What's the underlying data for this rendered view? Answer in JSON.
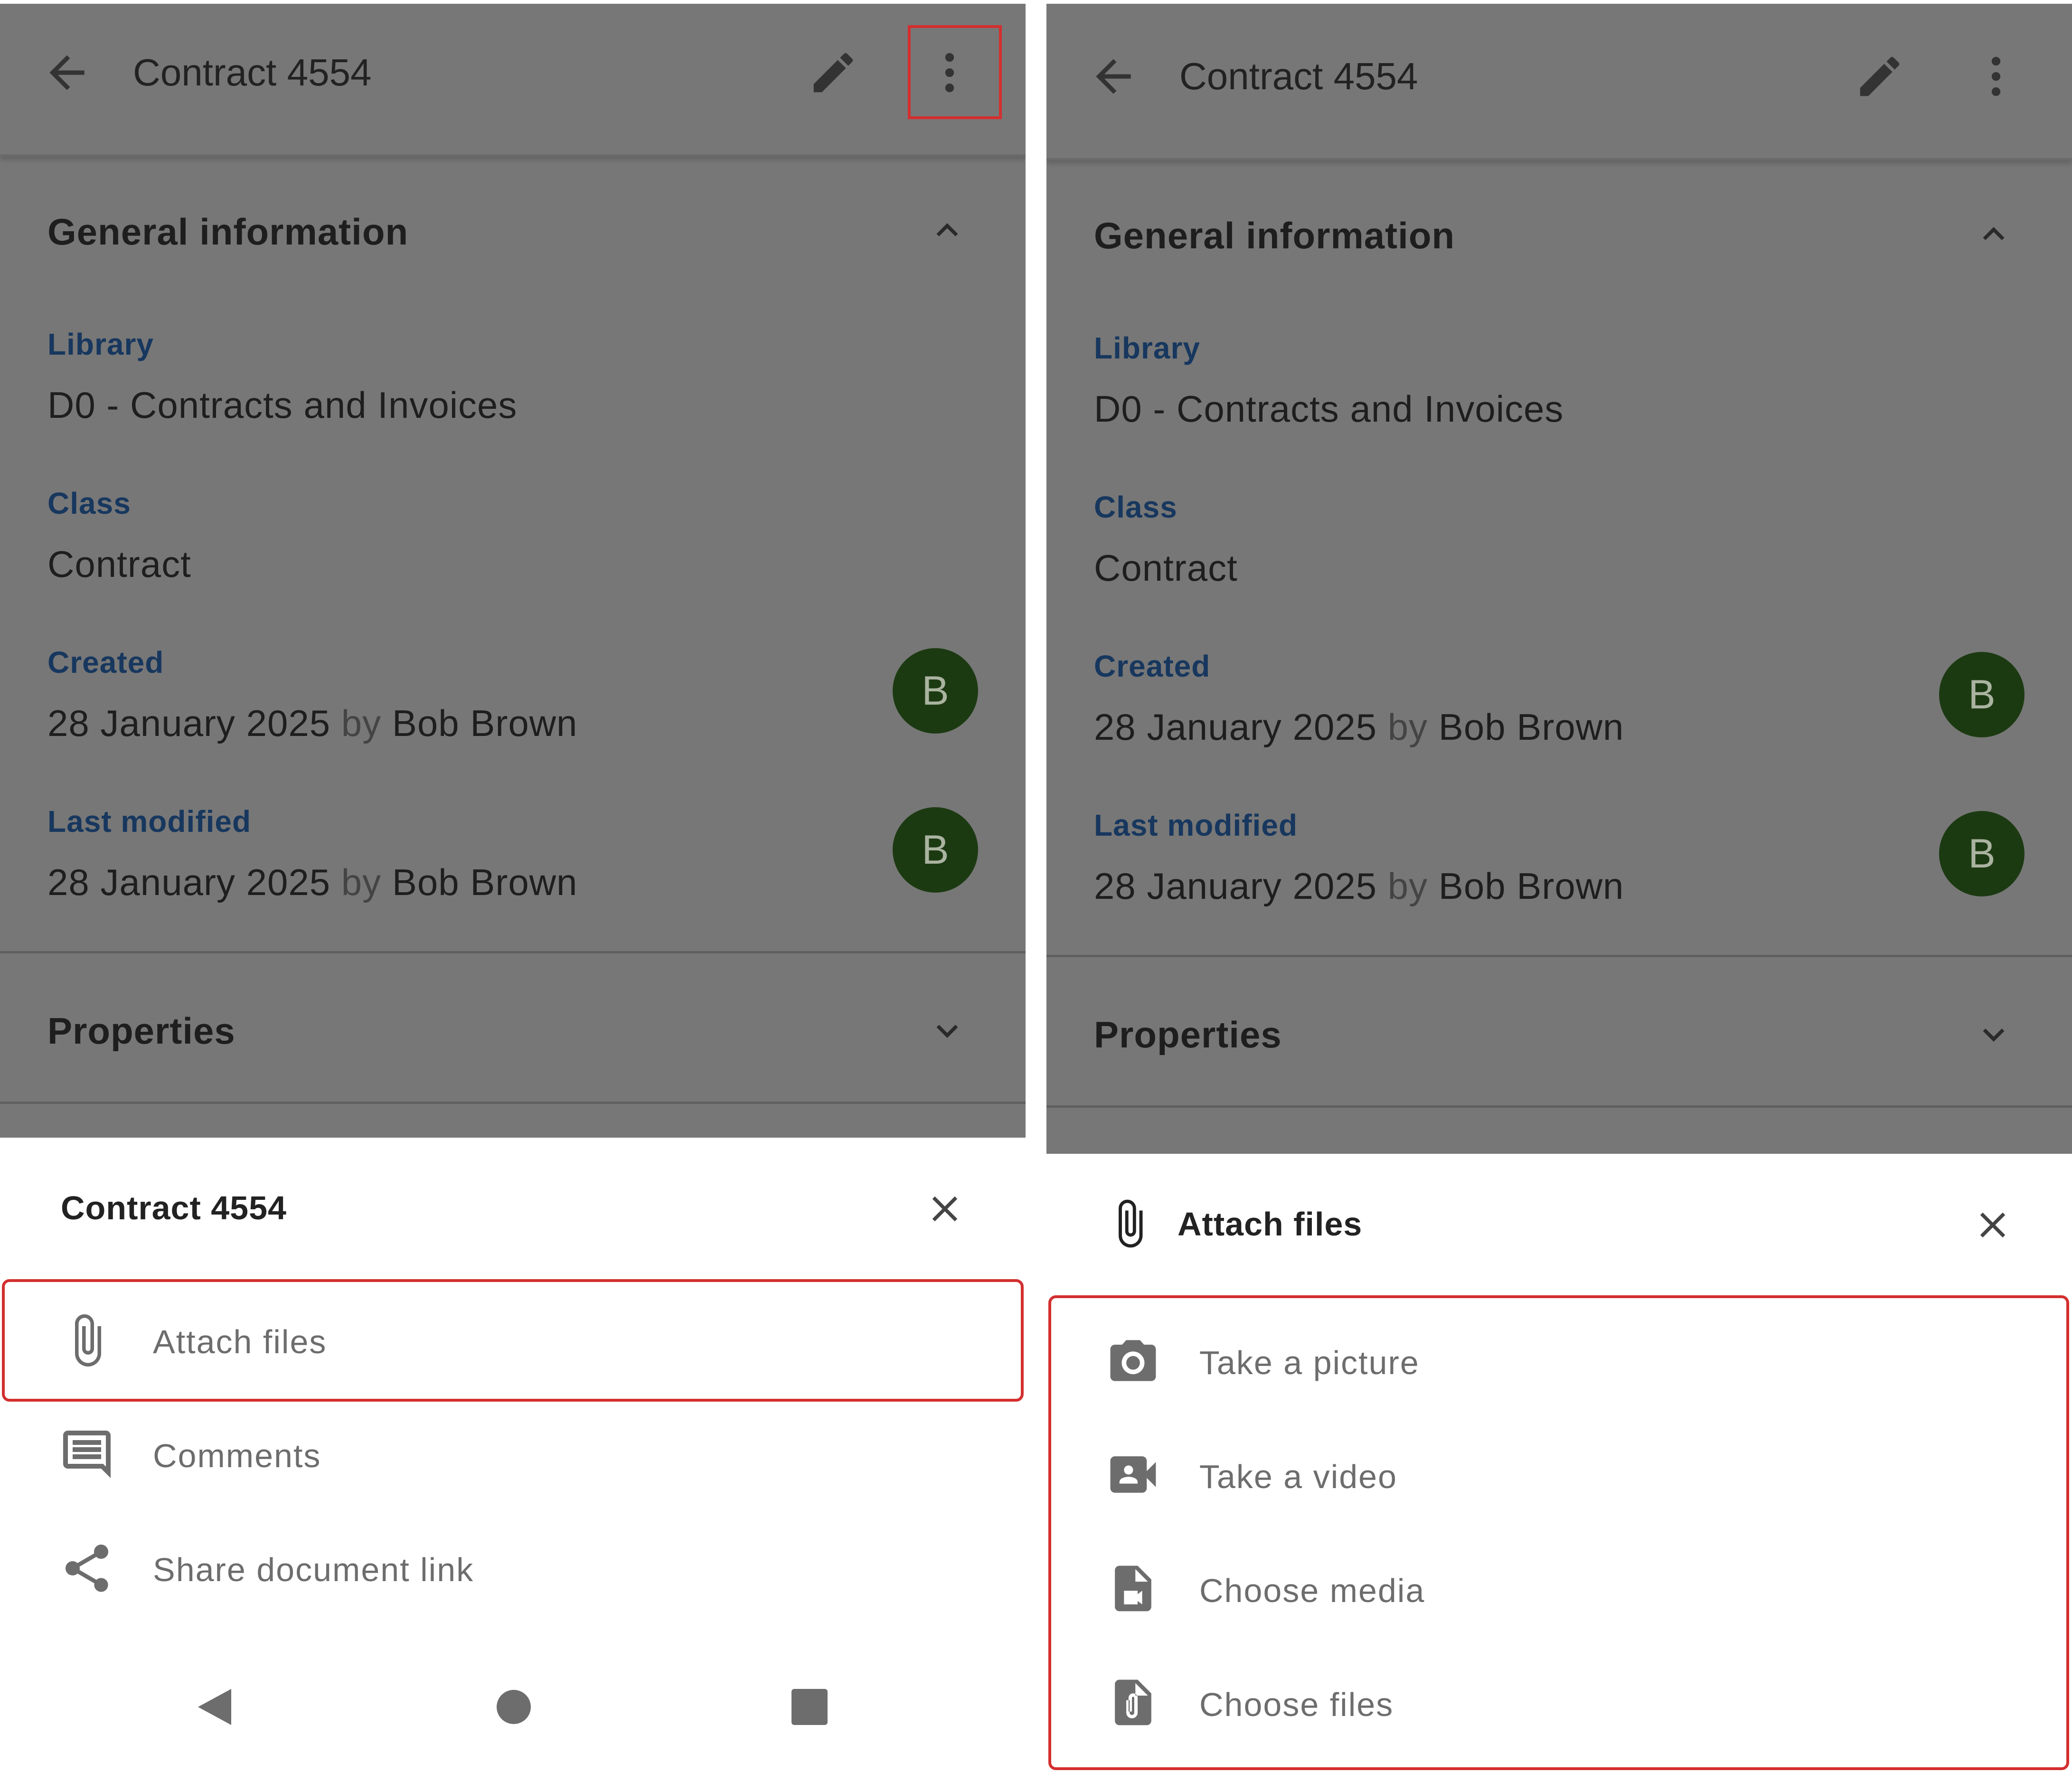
{
  "left_screen": {
    "app_bar": {
      "title": "Contract 4554"
    },
    "general_section": {
      "title": "General information"
    },
    "fields": {
      "library": {
        "label": "Library",
        "value": "D0 - Contracts and Invoices"
      },
      "class": {
        "label": "Class",
        "value": "Contract"
      },
      "created": {
        "label": "Created",
        "date": "28 January 2025",
        "by": "by",
        "user": "Bob Brown",
        "avatar": "B"
      },
      "last_modified": {
        "label": "Last modified",
        "date": "28 January 2025",
        "by": "by",
        "user": "Bob Brown",
        "avatar": "B"
      }
    },
    "properties_section": {
      "title": "Properties"
    },
    "sheet": {
      "title": "Contract 4554",
      "items": [
        {
          "label": "Attach files",
          "icon": "paperclip-icon"
        },
        {
          "label": "Comments",
          "icon": "comment-icon"
        },
        {
          "label": "Share document link",
          "icon": "share-icon"
        }
      ]
    }
  },
  "right_screen": {
    "app_bar": {
      "title": "Contract 4554"
    },
    "general_section": {
      "title": "General information"
    },
    "fields": {
      "library": {
        "label": "Library",
        "value": "D0 - Contracts and Invoices"
      },
      "class": {
        "label": "Class",
        "value": "Contract"
      },
      "created": {
        "label": "Created",
        "date": "28 January 2025",
        "by": "by",
        "user": "Bob Brown",
        "avatar": "B"
      },
      "last_modified": {
        "label": "Last modified",
        "date": "28 January 2025",
        "by": "by",
        "user": "Bob Brown",
        "avatar": "B"
      }
    },
    "properties_section": {
      "title": "Properties"
    },
    "sheet": {
      "title": "Attach files",
      "items": [
        {
          "label": "Take a picture",
          "icon": "camera-icon"
        },
        {
          "label": "Take a video",
          "icon": "video-icon"
        },
        {
          "label": "Choose media",
          "icon": "media-file-icon"
        },
        {
          "label": "Choose files",
          "icon": "attach-file-icon"
        }
      ]
    }
  },
  "colors": {
    "overlay": "#777777",
    "label_blue": "#17375e",
    "avatar_green": "#1c3a12",
    "highlight_red": "#d32f2f"
  }
}
